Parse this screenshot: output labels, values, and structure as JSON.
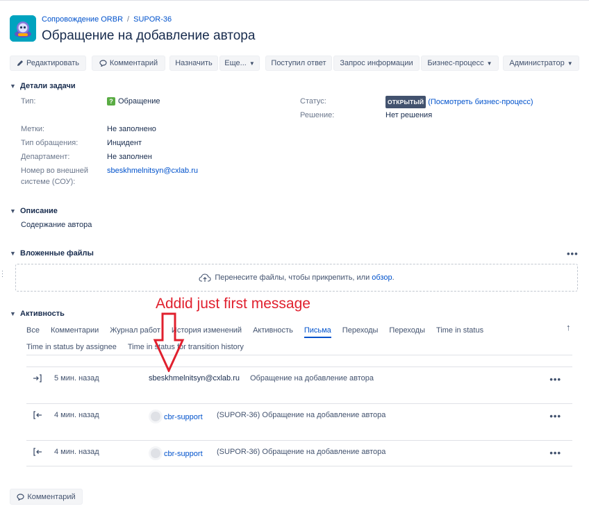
{
  "header": {
    "breadcrumb": [
      "Сопровождение ORBR",
      "SUPOR-36"
    ],
    "breadcrumb_sep": "/",
    "title": "Обращение на добавление автора"
  },
  "toolbar": {
    "edit": "Редактировать",
    "comment": "Комментарий",
    "assign": "Назначить",
    "more": "Еще...",
    "answer_received": "Поступил ответ",
    "info_request": "Запрос информации",
    "business_process": "Бизнес-процесс",
    "admin": "Администратор"
  },
  "details": {
    "heading": "Детали задачи",
    "type_label": "Тип:",
    "type_value": "Обращение",
    "type_icon_glyph": "?",
    "status_label": "Статус:",
    "status_value": "ОТКРЫТЫЙ",
    "status_link": "(Посмотреть бизнес-процесс)",
    "resolution_label": "Решение:",
    "resolution_value": "Нет решения",
    "labels_label": "Метки:",
    "labels_value": "Не заполнено",
    "request_type_label": "Тип обращения:",
    "request_type_value": "Инцидент",
    "department_label": "Департамент:",
    "department_value": "Не заполнен",
    "external_number_label_1": "Номер во внешней",
    "external_number_label_2": "системе (СОУ):",
    "external_number_value": "sbeskhmelnitsyn@cxlab.ru"
  },
  "description": {
    "heading": "Описание",
    "text": "Содержание автора"
  },
  "attachments": {
    "heading": "Вложенные файлы",
    "drop_text": "Перенесите файлы, чтобы прикрепить, или",
    "browse_link": "обзор",
    "drop_suffix": "."
  },
  "activity": {
    "heading": "Активность",
    "tabs": [
      "Все",
      "Комментарии",
      "Журнал работ",
      "История изменений",
      "Активность",
      "Письма",
      "Переходы",
      "Переходы",
      "Time in status"
    ],
    "tabs_row2": [
      "Time in status by assignee",
      "Time in status for transition history"
    ],
    "active_tab": "Письма",
    "rows": [
      {
        "direction": "incoming",
        "time": "5 мин. назад",
        "from": "sbeskhmelnitsyn@cxlab.ru",
        "subject": "Обращение на добавление автора"
      },
      {
        "direction": "outgoing",
        "time": "4 мин. назад",
        "from": "cbr-support",
        "subject": "(SUPOR-36) Обращение на добавление автора"
      },
      {
        "direction": "outgoing",
        "time": "4 мин. назад",
        "from": "cbr-support",
        "subject": "(SUPOR-36) Обращение на добавление автора"
      }
    ],
    "more_glyph": "•••"
  },
  "annotation": {
    "text": "Addid just first message",
    "color": "#e0202e"
  },
  "bottom": {
    "comment_button": "Комментарий"
  },
  "colors": {
    "accent": "#0052cc",
    "text": "#172b4d",
    "muted": "#6b778c",
    "status_lozenge": "#42526e",
    "type_icon": "#5aac44"
  }
}
